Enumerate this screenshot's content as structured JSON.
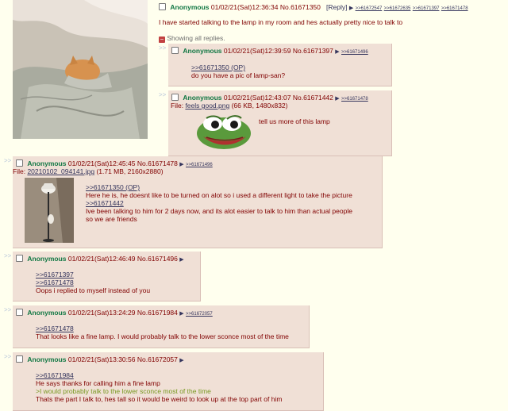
{
  "op": {
    "name": "Anonymous",
    "date": "01/02/21(Sat)12:36:34",
    "no": "No.61671350",
    "reply": "[Reply]",
    "backlinks": [
      ">>61672547",
      ">>61672635",
      ">>61671397",
      ">>61671478"
    ],
    "comment": "I have started talking to the lamp in my room and hes actually pretty nice to talk to",
    "showing_all": "Showing all replies."
  },
  "p1397": {
    "name": "Anonymous",
    "date": "01/02/21(Sat)12:39:59",
    "no": "No.61671397",
    "backlink": ">>61671496",
    "quote": ">>61671350 (OP)",
    "text": "do you have a pic of lamp-san?"
  },
  "p1442": {
    "name": "Anonymous",
    "date": "01/02/21(Sat)12:43:07",
    "no": "No.61671442",
    "backlink": ">>61671478",
    "file_label": "File:",
    "file_name": "feels good.png",
    "file_meta": "(66 KB, 1480x832)",
    "text": "tell us more of this lamp"
  },
  "p1478": {
    "name": "Anonymous",
    "date": "01/02/21(Sat)12:45:45",
    "no": "No.61671478",
    "backlink": ">>61671496",
    "file_label": "File:",
    "file_name": "20210102_094141.jpg",
    "file_meta": "(1.71 MB, 2160x2880)",
    "quote1": ">>61671350 (OP)",
    "text1": "Here he is, he doesnt like to be turned on alot so i used a different light to take the picture",
    "quote2": ">>61671442",
    "text2": "Ive been talking to him for 2 days now, and its alot easier to talk to him than actual people",
    "text3": "so we are friends"
  },
  "p1496": {
    "name": "Anonymous",
    "date": "01/02/21(Sat)12:46:49",
    "no": "No.61671496",
    "quote1": ">>61671397",
    "quote2": ">>61671478",
    "text": "Oops i replied to myself instead of you"
  },
  "p1984": {
    "name": "Anonymous",
    "date": "01/02/21(Sat)13:24:29",
    "no": "No.61671984",
    "backlink": ">>61672057",
    "quote": ">>61671478",
    "text": "That looks like a fine lamp. I would probably talk to the lower sconce most of the time"
  },
  "p2057": {
    "name": "Anonymous",
    "date": "01/02/21(Sat)13:30:56",
    "no": "No.61672057",
    "quote": ">>61671984",
    "text1": "He says thanks for calling him a fine lamp",
    "greentext": ">I would probably talk to the lower sconce most of the time",
    "text2": "Thats the part I talk to, hes tall so it would be weird to look up at the top part of him"
  },
  "ui": {
    "side_arrows": ">>",
    "menu_arrow": "▶",
    "minus": "−"
  },
  "colors": {
    "post_bg": "#f0e0d6",
    "page_bg": "#ffffee",
    "name": "#117743",
    "link": "#34345c",
    "greentext": "#789922"
  }
}
